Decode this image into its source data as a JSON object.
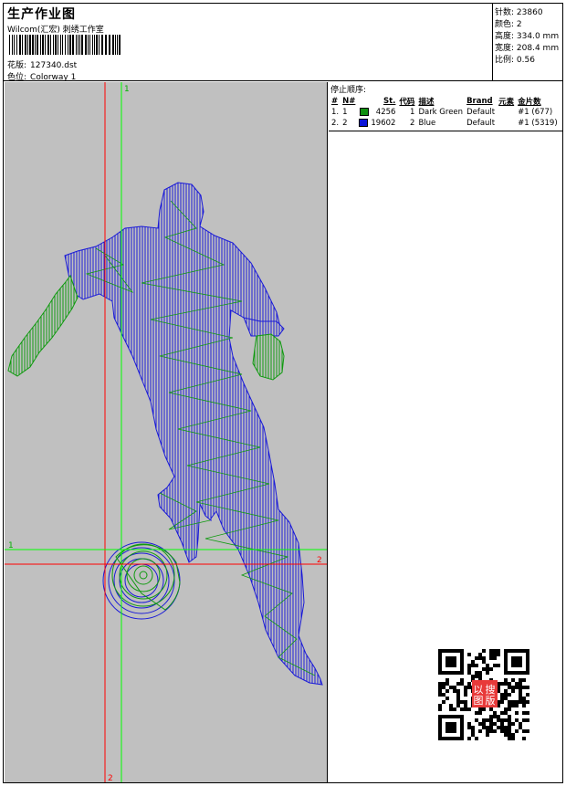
{
  "header": {
    "title": "生产作业图",
    "company": "Wilcom(汇宏) 刺绣工作室",
    "design_label": "花版:",
    "design_value": "127340.dst",
    "colorway_label": "色位:",
    "colorway_value": "Colorway 1"
  },
  "stats": [
    {
      "label": "针数:",
      "value": "23860"
    },
    {
      "label": "颜色:",
      "value": "2"
    },
    {
      "label": "高度:",
      "value": "334.0 mm"
    },
    {
      "label": "宽度:",
      "value": "208.4 mm"
    },
    {
      "label": "比例:",
      "value": "0.56"
    }
  ],
  "stop_sequence": {
    "title": "停止顺序:",
    "columns": [
      "#",
      "N#",
      "St.",
      "代码",
      "描述",
      "Brand",
      "元素",
      "金片数"
    ],
    "rows": [
      {
        "num": "1.",
        "n": "1",
        "color": "#109010",
        "stitches": "4256",
        "code": "1",
        "desc": "Dark Green",
        "brand": "Default",
        "element": "#1 (677)"
      },
      {
        "num": "2.",
        "n": "2",
        "color": "#0a14d8",
        "stitches": "19602",
        "code": "2",
        "desc": "Blue",
        "brand": "Default",
        "element": "#1 (5319)"
      }
    ]
  },
  "preview": {
    "background": "#c0c0c0",
    "guide_red": "#ff0000",
    "guide_green": "#00ff00",
    "axis_labels": {
      "v_green_top": "1",
      "h_green_left": "1",
      "h_red_right": "2",
      "v_red_bottom": "2"
    }
  },
  "qr": {
    "stamp_text": [
      "以",
      "图",
      "搜",
      "版"
    ],
    "stamp_color": "#e83a3a"
  }
}
